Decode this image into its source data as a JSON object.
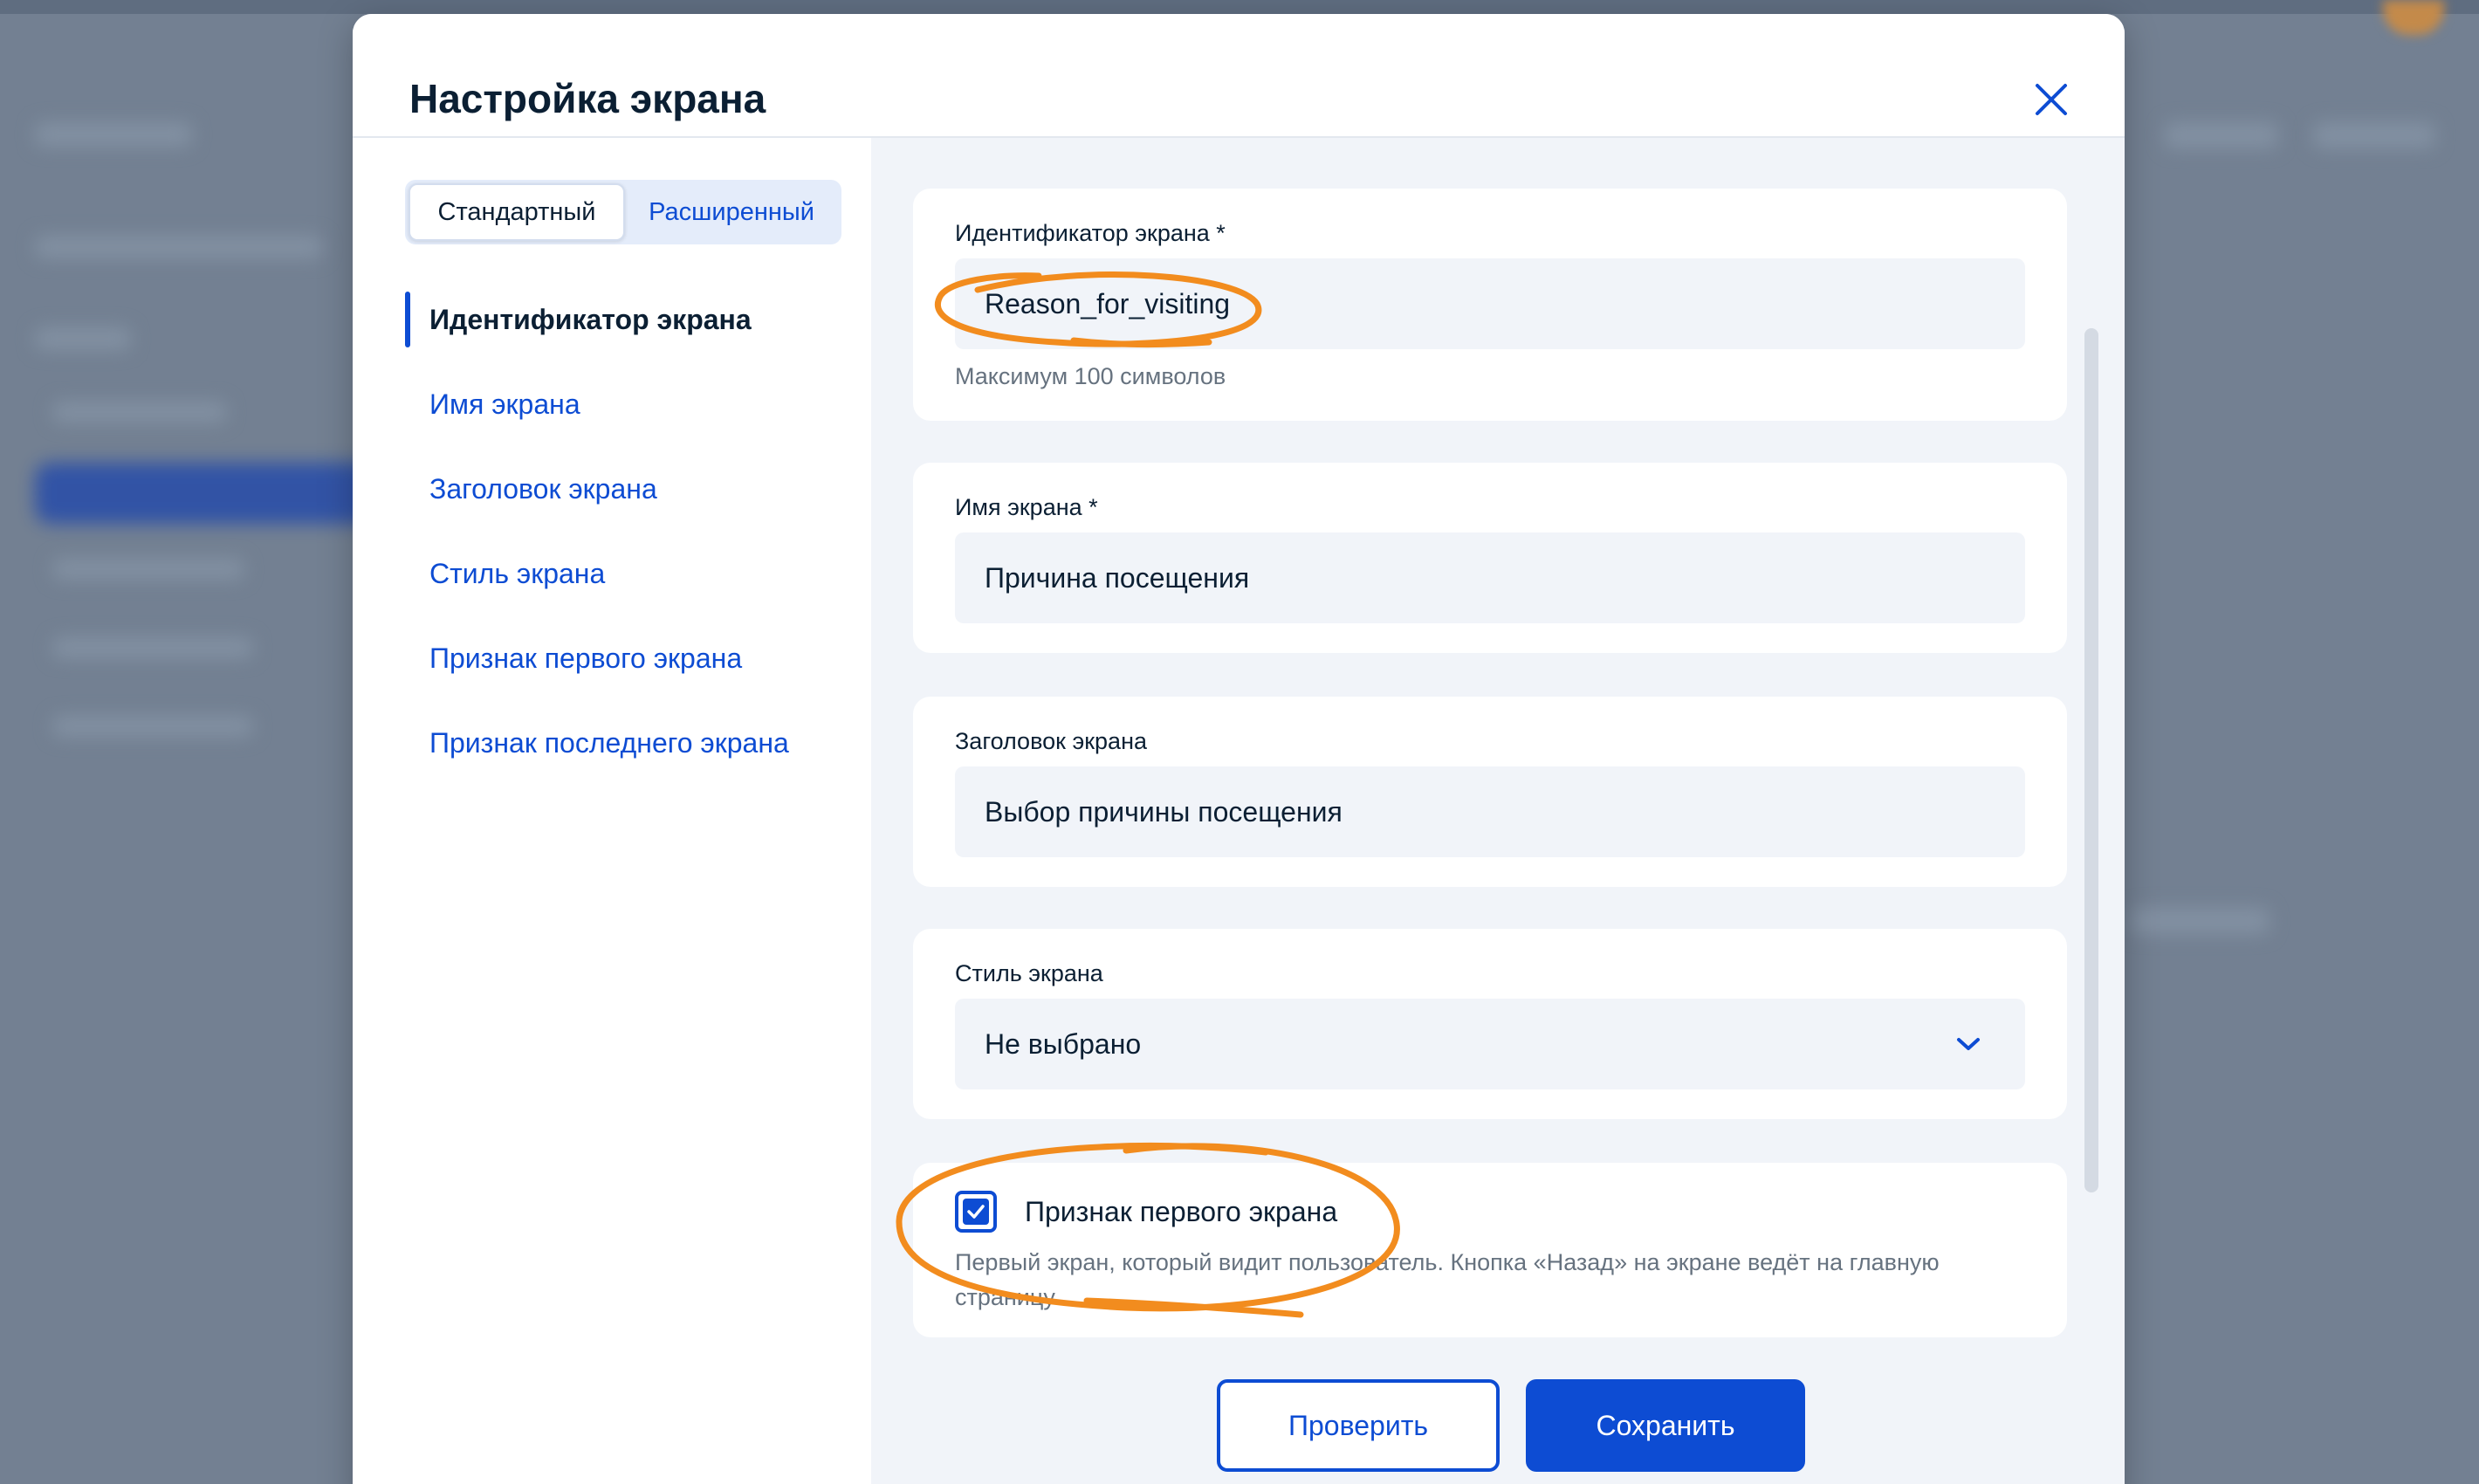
{
  "modal": {
    "title": "Настройка экрана",
    "close_icon": "close-icon"
  },
  "tabs": {
    "standard": "Стандартный",
    "extended": "Расширенный",
    "selected": "standard"
  },
  "nav": {
    "items": [
      {
        "label": "Идентификатор экрана",
        "active": true
      },
      {
        "label": "Имя экрана",
        "active": false
      },
      {
        "label": "Заголовок экрана",
        "active": false
      },
      {
        "label": "Стиль экрана",
        "active": false
      },
      {
        "label": "Признак первого экрана",
        "active": false
      },
      {
        "label": "Признак последнего экрана",
        "active": false
      }
    ]
  },
  "form": {
    "screen_id": {
      "label": "Идентификатор экрана *",
      "value": "Reason_for_visiting",
      "hint": "Максимум 100 символов"
    },
    "screen_name": {
      "label": "Имя экрана *",
      "value": "Причина посещения"
    },
    "screen_header": {
      "label": "Заголовок экрана",
      "value": "Выбор причины посещения"
    },
    "screen_style": {
      "label": "Стиль экрана",
      "value": "Не выбрано"
    },
    "first_screen": {
      "label": "Признак первого экрана",
      "checked": true,
      "description": "Первый экран, который видит пользователь. Кнопка «Назад» на экране ведёт на главную страницу"
    }
  },
  "buttons": {
    "check": "Проверить",
    "save": "Сохранить"
  },
  "colors": {
    "accent": "#0d4cd3",
    "text": "#0b1f33",
    "muted": "#66727f",
    "annotation": "#f28c1e"
  }
}
